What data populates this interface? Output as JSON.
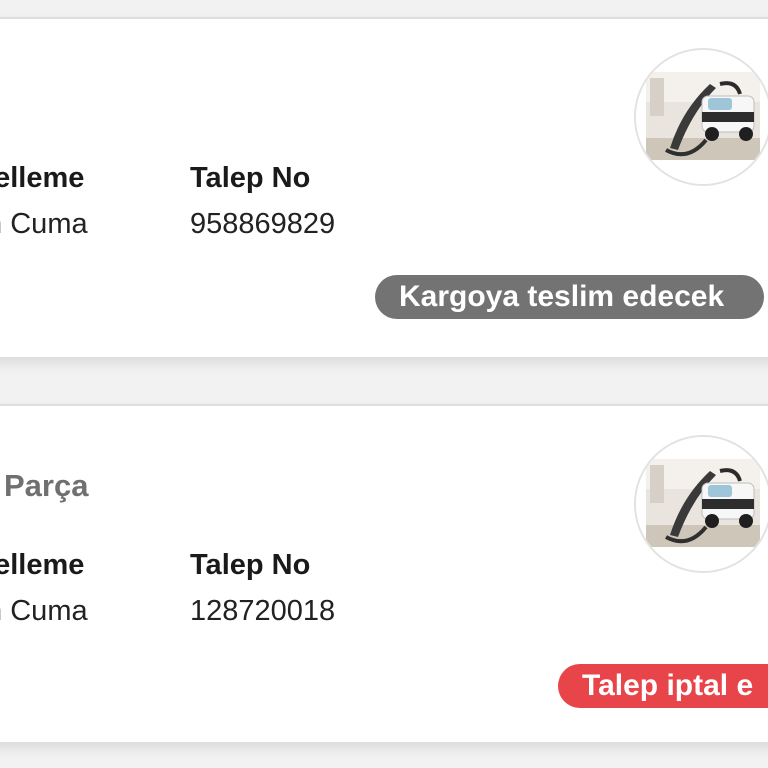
{
  "cards": [
    {
      "title": "",
      "update_header": "Güncelleme",
      "update_value": "Kasım Cuma",
      "request_header": "Talep No",
      "request_value": "958869829",
      "product_image": "steam-vacuum-cleaner-photo",
      "status": "Kargoya teslim edecek",
      "status_color": "#737373"
    },
    {
      "title": "Parça",
      "update_header": "Güncelleme",
      "update_value": "Kasım Cuma",
      "request_header": "Talep No",
      "request_value": "128720018",
      "product_image": "steam-vacuum-cleaner-photo",
      "status": "Talep iptal e",
      "status_color": "#e8454a"
    }
  ]
}
